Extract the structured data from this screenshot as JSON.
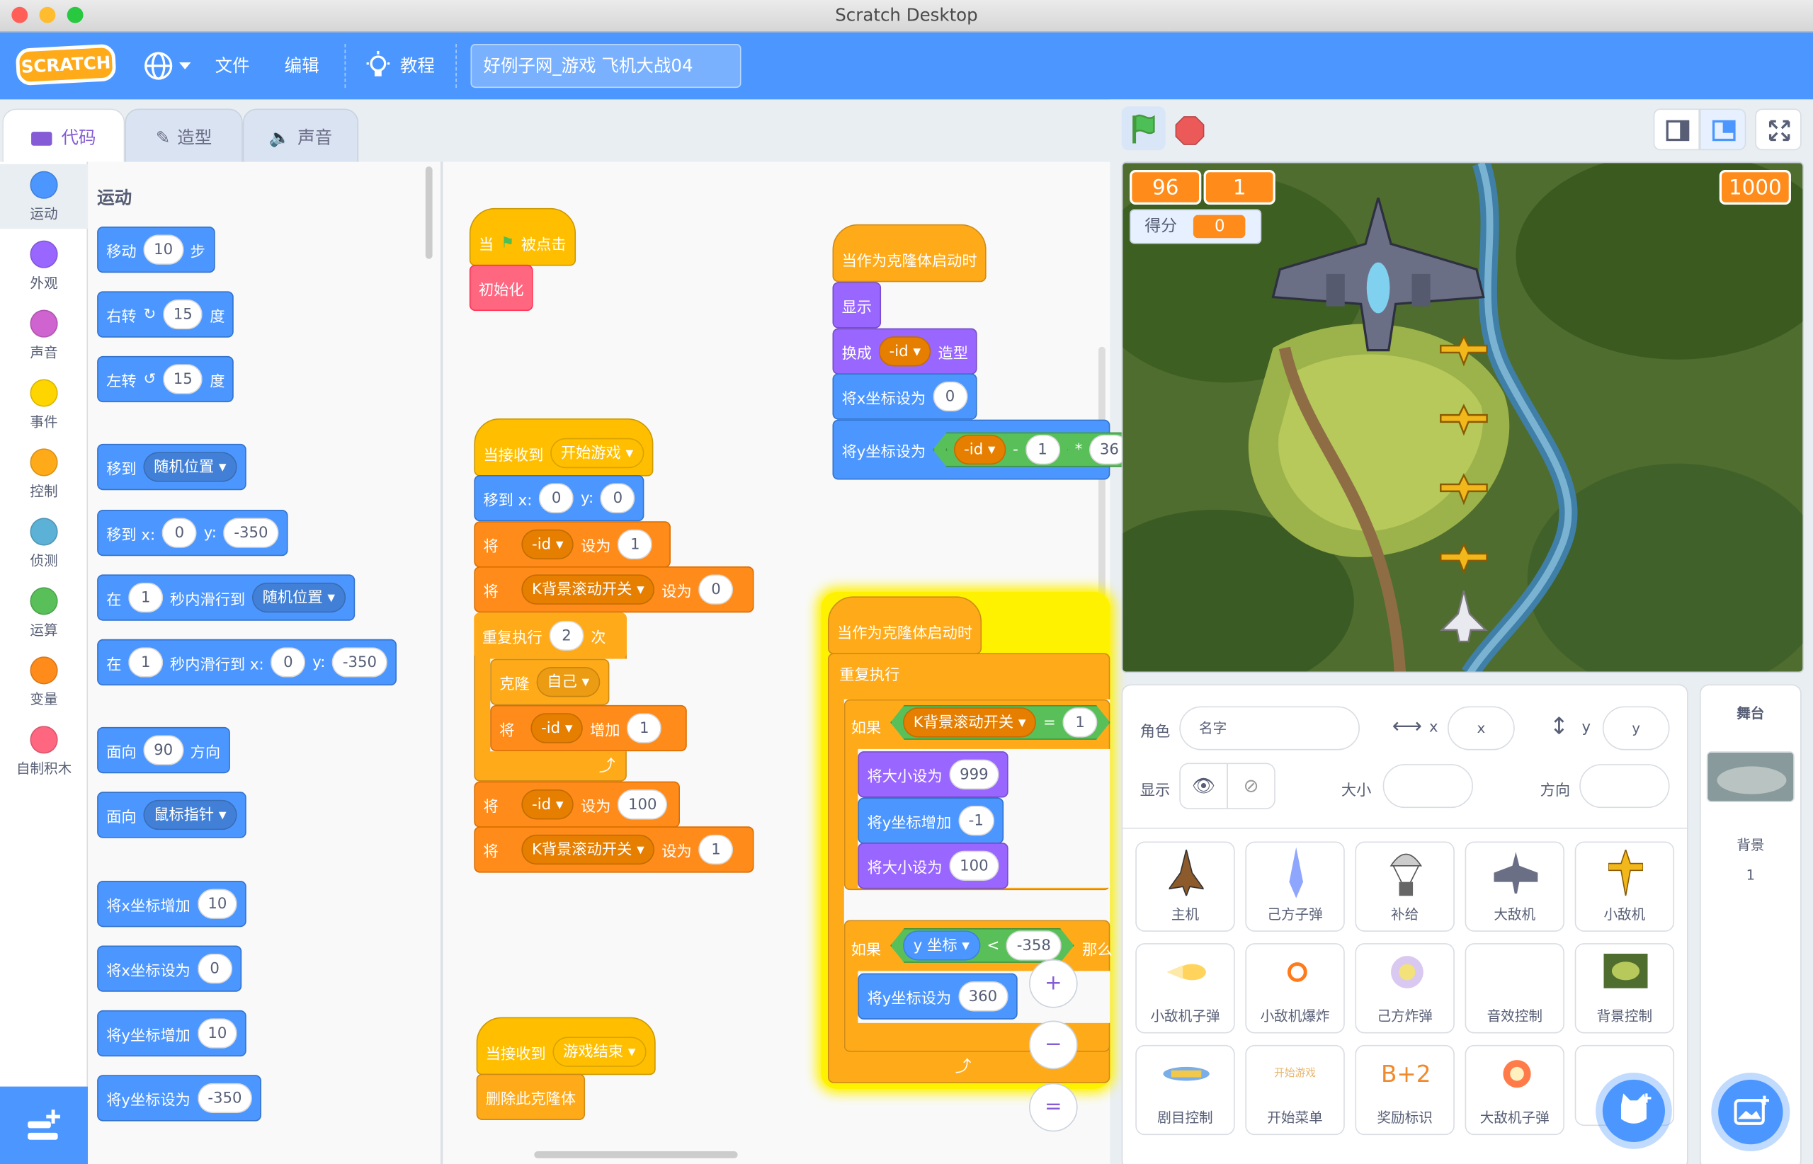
{
  "window": {
    "title": "Scratch Desktop"
  },
  "menubar": {
    "logo": "SCRATCH",
    "file": "文件",
    "edit": "编辑",
    "tutorials": "教程",
    "project_title": "好例子网_游戏 飞机大战04"
  },
  "tabs": {
    "code": "代码",
    "costumes": "造型",
    "sounds": "声音"
  },
  "categories": {
    "motion": "运动",
    "looks": "外观",
    "sound": "声音",
    "events": "事件",
    "control": "控制",
    "sensing": "侦测",
    "operators": "运算",
    "variables": "变量",
    "myblocks": "自制积木"
  },
  "colors": {
    "motion": "#4c97ff",
    "looks": "#9966ff",
    "sound": "#cf63cf",
    "events": "#ffd500",
    "control": "#ffab19",
    "sensing": "#5cb1d6",
    "operators": "#59c059",
    "variables": "#ff8c1a",
    "myblocks": "#ff6680"
  },
  "palette": {
    "heading": "运动",
    "move": {
      "a": "移动",
      "v": "10",
      "b": "步"
    },
    "turn_r": {
      "a": "右转",
      "v": "15",
      "b": "度"
    },
    "turn_l": {
      "a": "左转",
      "v": "15",
      "b": "度"
    },
    "goto": {
      "a": "移到",
      "dd": "随机位置"
    },
    "gotoxy": {
      "a": "移到 x:",
      "x": "0",
      "b": "y:",
      "y": "-350"
    },
    "glide": {
      "a": "在",
      "v": "1",
      "b": "秒内滑行到",
      "dd": "随机位置"
    },
    "glidexy": {
      "a": "在",
      "v": "1",
      "b": "秒内滑行到 x:",
      "x": "0",
      "c": "y:",
      "y": "-350"
    },
    "point": {
      "a": "面向",
      "v": "90",
      "b": "方向"
    },
    "towards": {
      "a": "面向",
      "dd": "鼠标指针"
    },
    "chx": {
      "a": "将x坐标增加",
      "v": "10"
    },
    "setx": {
      "a": "将x坐标设为",
      "v": "0"
    },
    "chy": {
      "a": "将y坐标增加",
      "v": "10"
    },
    "sety": {
      "a": "将y坐标设为",
      "v": "-350"
    }
  },
  "script1": {
    "hat_a": "当",
    "hat_b": "被点击",
    "call": "初始化"
  },
  "script2": {
    "hat": "当接收到",
    "msg": "开始游戏",
    "goto_a": "移到 x:",
    "x": "0",
    "goto_b": "y:",
    "y": "0",
    "set": "将",
    "var1": "-id",
    "setto": "设为",
    "v1": "1",
    "var2": "K背景滚动开关",
    "v2": "0",
    "repeat": "重复执行",
    "times": "2",
    "times_b": "次",
    "clone": "克隆",
    "self": "自己",
    "change": "增加",
    "cv": "1",
    "v3": "100",
    "v4": "1"
  },
  "script3": {
    "hat": "当作为克隆体启动时",
    "show": "显示",
    "switch_a": "换成",
    "switch_b": "造型",
    "setx": "将x坐标设为",
    "sx": "0",
    "sety": "将y坐标设为",
    "one": "1",
    "n36": "36",
    "var": "-id",
    "minus": "-",
    "times": "*"
  },
  "script4": {
    "hat": "当作为克隆体启动时",
    "forever": "重复执行",
    "if": "如果",
    "var": "K背景滚动开关",
    "eq": "=",
    "one": "1",
    "size": "将大小设为",
    "s999": "999",
    "chy": "将y坐标增加",
    "m1": "-1",
    "s100": "100",
    "ycoord": "y 坐标",
    "lt": "<",
    "n358": "-358",
    "then": "那么",
    "sety": "将y坐标设为",
    "n360": "360"
  },
  "script5": {
    "hat": "当接收到",
    "msg": "游戏结束",
    "del": "删除此克隆体"
  },
  "zoom": {
    "in": "+",
    "out": "−",
    "reset": "="
  },
  "stage": {
    "mon1": "96",
    "mon2": "1",
    "mon3": "1000",
    "score_label": "得分",
    "score": "0"
  },
  "sprite_info": {
    "sprite": "角色",
    "name_ph": "名字",
    "x": "x",
    "y": "y",
    "show": "显示",
    "size": "大小",
    "direction": "方向"
  },
  "sprites": [
    "主机",
    "己方子弹",
    "补给",
    "大敌机",
    "小敌机",
    "小敌机子弹",
    "小敌机爆炸",
    "己方炸弹",
    "音效控制",
    "背景控制",
    "剧目控制",
    "开始菜单",
    "奖励标识",
    "大敌机子弹"
  ],
  "sprite_text": {
    "banner": "开始游戏",
    "bonus": "B+2"
  },
  "stage_panel": {
    "title": "舞台",
    "backdrop": "背景",
    "count": "1"
  }
}
